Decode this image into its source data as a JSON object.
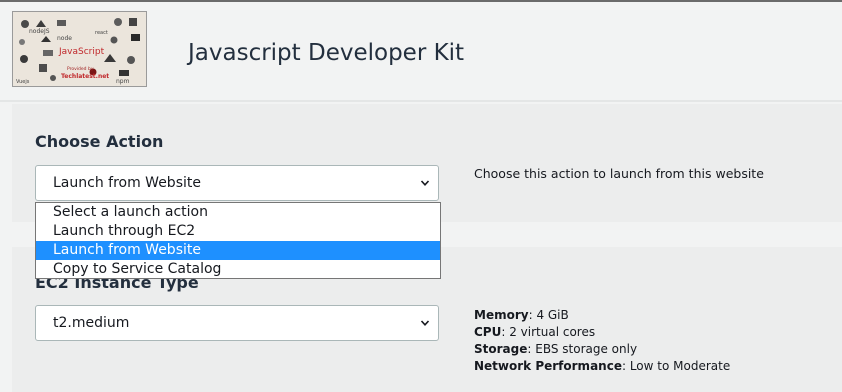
{
  "header": {
    "title": "Javascript Developer Kit",
    "logo": {
      "main_text": "JavaScript",
      "sub_text": "Provided by",
      "brand_text": "Techlatest.net",
      "scattered_labels": [
        "nodeJS",
        "node",
        "npm",
        "Vuejs",
        "react"
      ]
    }
  },
  "choose_action": {
    "label": "Choose Action",
    "selected_value": "Launch from Website",
    "help_text": "Choose this action to launch from this website",
    "options": [
      {
        "label": "Select a launch action",
        "selected": false
      },
      {
        "label": "Launch through EC2",
        "selected": false
      },
      {
        "label": "Launch from Website",
        "selected": true
      },
      {
        "label": "Copy to Service Catalog",
        "selected": false
      }
    ]
  },
  "instance_type": {
    "label": "EC2 Instance Type",
    "selected_value": "t2.medium",
    "specs": [
      {
        "key": "Memory",
        "value": "4 GiB"
      },
      {
        "key": "CPU",
        "value": "2 virtual cores"
      },
      {
        "key": "Storage",
        "value": "EBS storage only"
      },
      {
        "key": "Network Performance",
        "value": "Low to Moderate"
      }
    ]
  },
  "colors": {
    "highlight": "#1e90ff",
    "section_bg": "#eceded",
    "page_bg": "#f2f3f3"
  },
  "icons": [
    "chevron-down-icon"
  ]
}
